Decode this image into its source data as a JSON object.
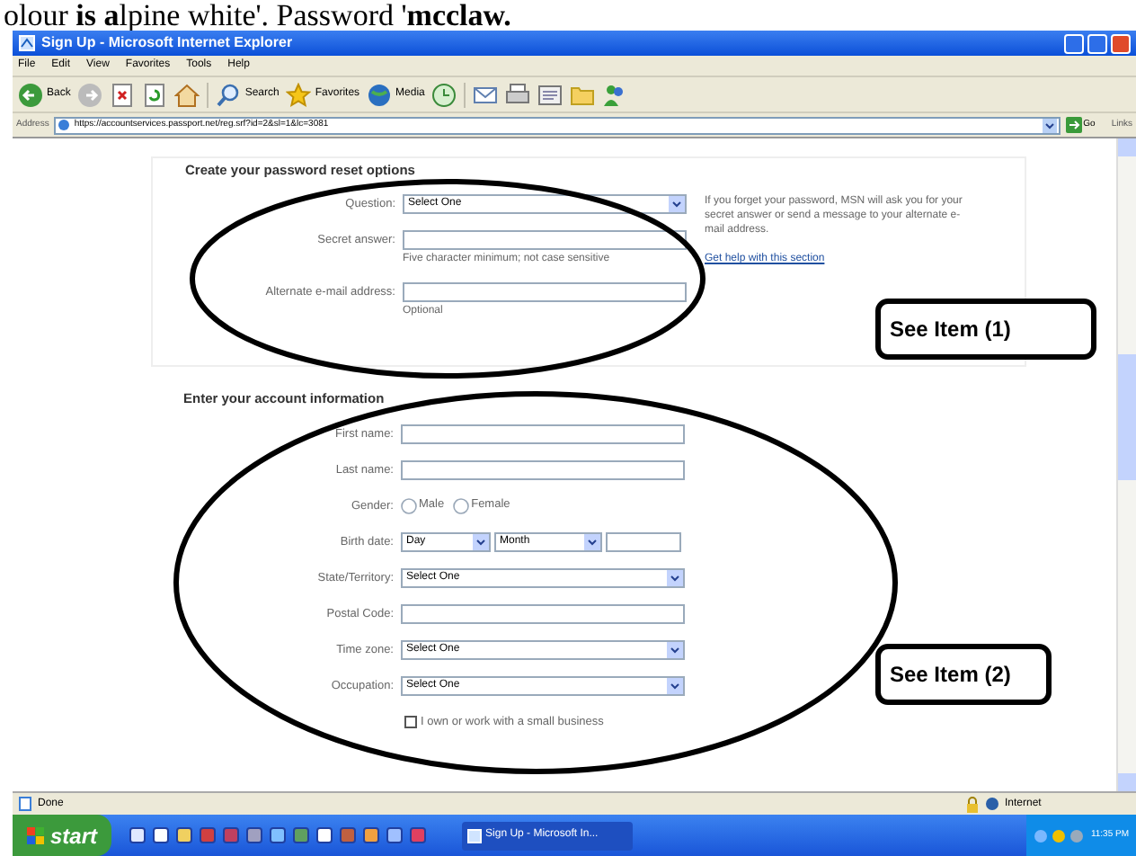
{
  "document_text": "olour **is a**lpine white'. Password '**mcclaw.**",
  "window": {
    "title": "Sign Up - Microsoft Internet Explorer"
  },
  "menu": [
    "File",
    "Edit",
    "View",
    "Favorites",
    "Tools",
    "Help"
  ],
  "toolbar": [
    {
      "kind": "back",
      "label": "Back"
    },
    {
      "kind": "forward"
    },
    {
      "kind": "stop"
    },
    {
      "kind": "refresh"
    },
    {
      "kind": "home"
    },
    {
      "kind": "search",
      "label": "Search"
    },
    {
      "kind": "favorites",
      "label": "Favorites"
    },
    {
      "kind": "media",
      "label": "Media"
    },
    {
      "kind": "history"
    },
    {
      "kind": "mail"
    },
    {
      "kind": "print"
    },
    {
      "kind": "edit"
    },
    {
      "kind": "folder"
    },
    {
      "kind": "messenger"
    }
  ],
  "address": {
    "label": "Address",
    "value": "https://accountservices.passport.net/reg.srf?id=2&sl=1&lc=3081",
    "go": "Go",
    "links": "Links"
  },
  "sections": [
    {
      "heading": "Create your password reset options",
      "fields": [
        {
          "kind": "select",
          "label": "Question:",
          "value": "Select One"
        },
        {
          "kind": "text",
          "label": "Secret answer:",
          "hint": "Five character minimum; not case sensitive"
        },
        {
          "kind": "text",
          "label": "Alternate e-mail address:",
          "hint": "Optional"
        }
      ],
      "help": {
        "text": "If you forget your password, MSN will ask you for your secret answer or send a message to your alternate e-mail address.",
        "link": "Get help with this section"
      }
    },
    {
      "heading": "Enter your account information",
      "fields": [
        {
          "kind": "text",
          "label": "First name:"
        },
        {
          "kind": "text",
          "label": "Last name:"
        },
        {
          "kind": "radio",
          "label": "Gender:",
          "options": [
            {
              "label": "Male",
              "selected": false
            },
            {
              "label": "Female",
              "selected": false
            }
          ]
        },
        {
          "kind": "date",
          "label": "Birth date:",
          "day": "Day",
          "month": "Month"
        },
        {
          "kind": "select",
          "label": "State/Territory:",
          "value": "Select One"
        },
        {
          "kind": "text",
          "label": "Postal Code:"
        },
        {
          "kind": "select",
          "label": "Time zone:",
          "value": "Select One"
        },
        {
          "kind": "select",
          "label": "Occupation:",
          "value": "Select One"
        }
      ],
      "checkbox": {
        "label": "I own or work with a small business",
        "checked": false
      }
    }
  ],
  "callouts": [
    {
      "text": "See Item (1)"
    },
    {
      "text": "See Item (2)"
    }
  ],
  "status": {
    "text": "Done",
    "zone": "Internet"
  },
  "taskbar": {
    "start": "start",
    "task": "Sign Up - Microsoft In...",
    "clock": "11:35 PM"
  }
}
